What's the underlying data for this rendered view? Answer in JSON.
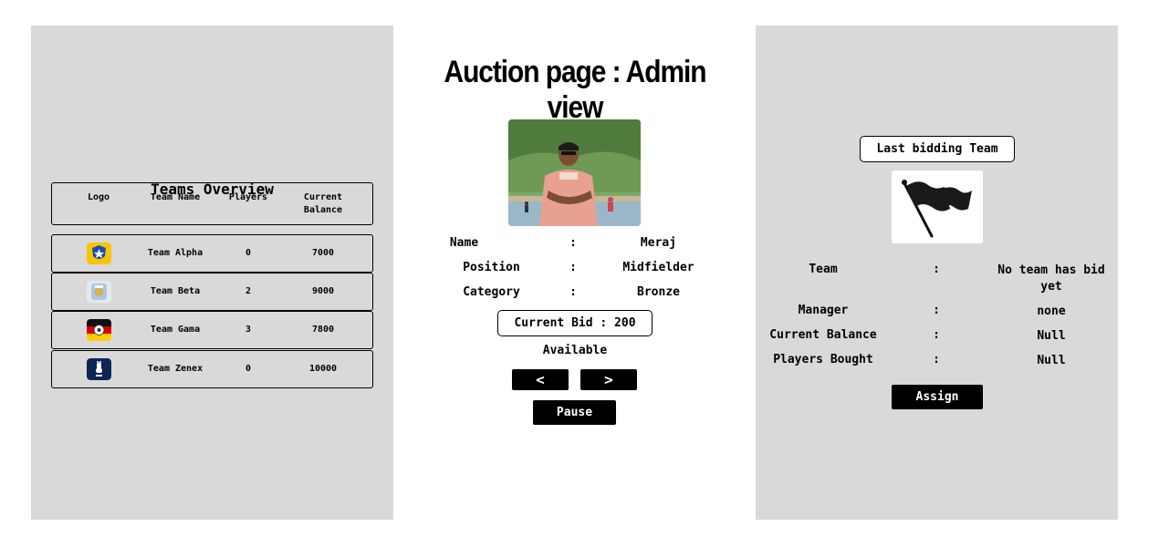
{
  "page": {
    "title": "Auction page : Admin view"
  },
  "teams_panel": {
    "title": "Teams Overview",
    "headers": {
      "logo": "Logo",
      "team_name": "Team Name",
      "players": "Players",
      "balance": "Current Balance"
    },
    "rows": [
      {
        "name": "Team Alpha",
        "players": "0",
        "balance": "7000",
        "logo_icon": "team-alpha-shield-logo"
      },
      {
        "name": "Team Beta",
        "players": "2",
        "balance": "9000",
        "logo_icon": "team-beta-crest-logo"
      },
      {
        "name": "Team Gama",
        "players": "3",
        "balance": "7800",
        "logo_icon": "team-gama-german-flag-logo"
      },
      {
        "name": "Team Zenex",
        "players": "0",
        "balance": "10000",
        "logo_icon": "team-zenex-rooster-logo"
      }
    ]
  },
  "player": {
    "photo_icon": "player-photo",
    "fields": [
      {
        "label": "Name",
        "colon": ":",
        "value": "Meraj"
      },
      {
        "label": "Position",
        "colon": ":",
        "value": "Midfielder"
      },
      {
        "label": "Category",
        "colon": ":",
        "value": "Bronze"
      }
    ],
    "current_bid": "Current Bid : 200",
    "status": "Available",
    "prev_label": "<",
    "next_label": ">",
    "pause_label": "Pause"
  },
  "last_bidding": {
    "title": "Last bidding Team",
    "flag_icon": "waving-flag-icon",
    "fields": [
      {
        "label": "Team",
        "colon": ":",
        "value": "No team has bid yet"
      },
      {
        "label": "Manager",
        "colon": ":",
        "value": "none"
      },
      {
        "label": "Current Balance",
        "colon": ":",
        "value": "Null"
      },
      {
        "label": "Players Bought",
        "colon": ":",
        "value": "Null"
      }
    ],
    "assign_label": "Assign"
  },
  "colors": {
    "panel_bg": "#d9d9d9",
    "button_bg": "#000000",
    "button_text": "#ffffff"
  }
}
